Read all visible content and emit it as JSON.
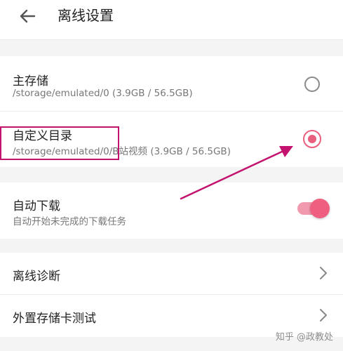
{
  "header": {
    "title": "离线设置",
    "back_icon": "arrow-left-icon"
  },
  "storage": {
    "main": {
      "title": "主存储",
      "path": "/storage/emulated/0 (3.9GB / 56.5GB)",
      "selected": false
    },
    "custom": {
      "title": "自定义目录",
      "path": "/storage/emulated/0/B站视频 (3.9GB / 56.5GB)",
      "selected": true
    }
  },
  "auto_download": {
    "title": "自动下载",
    "subtitle": "自动开始未完成的下载任务",
    "enabled": true
  },
  "tools": {
    "diagnose": {
      "title": "离线诊断"
    },
    "sdcard_test": {
      "title": "外置存储卡测试"
    }
  },
  "annotation": {
    "color": "#c4136e"
  },
  "colors": {
    "accent": "#e9607f",
    "background": "#f4f4f4",
    "card": "#ffffff"
  },
  "watermark": "知乎 @政教处"
}
